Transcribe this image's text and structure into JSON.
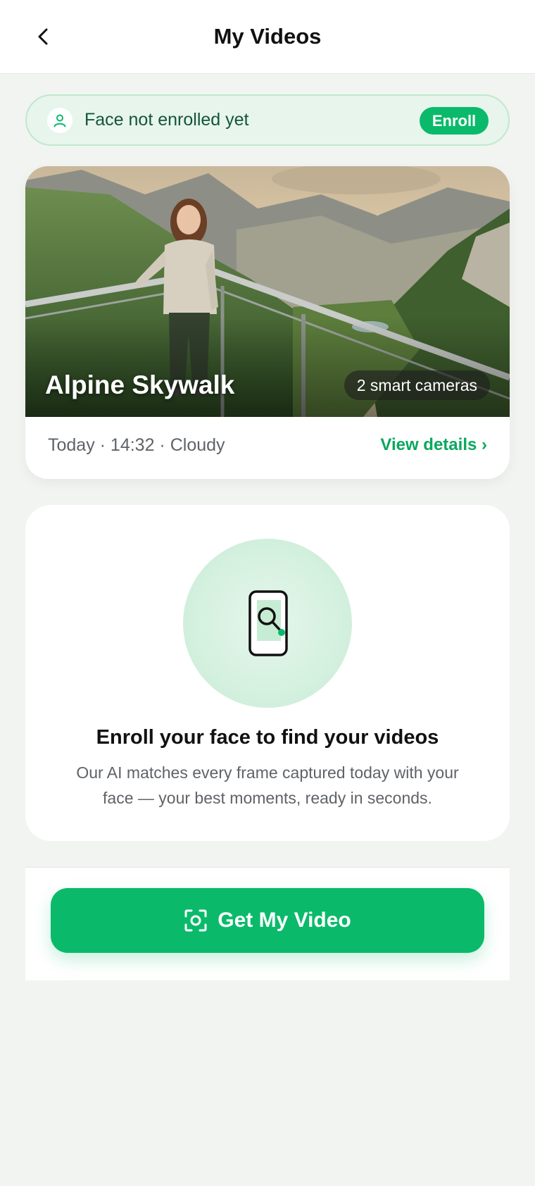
{
  "header": {
    "title": "My Videos",
    "back_icon": "chevron-left-icon"
  },
  "banner": {
    "text": "Face not enrolled yet",
    "icon": "user-icon",
    "button_label": "Enroll"
  },
  "event": {
    "title": "Alpine Skywalk",
    "camera_badge": "2 smart cameras",
    "meta": "Today · 14:32 · Cloudy",
    "details_link": "View details ›"
  },
  "info": {
    "icon": "phone-search-icon",
    "title": "Enroll your face to find your videos",
    "description": "Our AI matches every frame captured today with your face — your best moments, ready in seconds."
  },
  "cta": {
    "label": "Get My Video",
    "icon": "face-scan-icon"
  },
  "colors": {
    "accent": "#0aba6a",
    "banner_bg": "#e7f5ec",
    "link": "#0aa85e",
    "page_bg": "#f2f4f1"
  }
}
